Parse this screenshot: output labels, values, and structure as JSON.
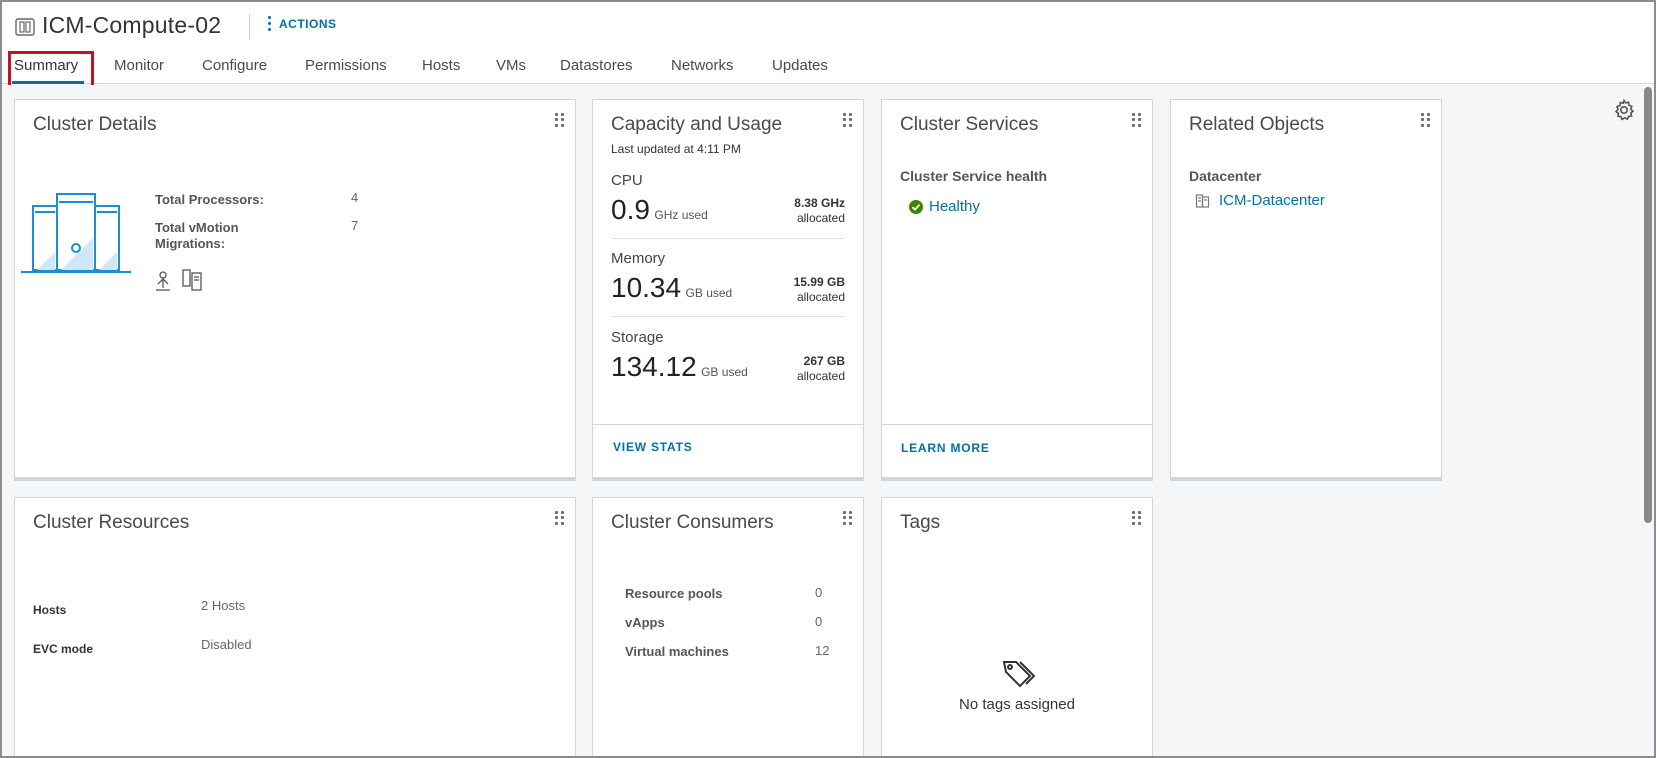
{
  "header": {
    "title": "ICM-Compute-02",
    "actions_label": "ACTIONS"
  },
  "tabs": [
    {
      "label": "Summary",
      "active": true
    },
    {
      "label": "Monitor"
    },
    {
      "label": "Configure"
    },
    {
      "label": "Permissions"
    },
    {
      "label": "Hosts"
    },
    {
      "label": "VMs"
    },
    {
      "label": "Datastores"
    },
    {
      "label": "Networks"
    },
    {
      "label": "Updates"
    }
  ],
  "cluster_details": {
    "title": "Cluster Details",
    "rows": [
      {
        "label": "Total Processors:",
        "value": "4"
      },
      {
        "label": "Total vMotion Migrations:",
        "value": "7"
      }
    ]
  },
  "capacity": {
    "title": "Capacity and Usage",
    "last_updated": "Last updated at 4:11 PM",
    "metrics": [
      {
        "name": "CPU",
        "used": "0.9",
        "unit": "GHz used",
        "allocated": "8.38 GHz",
        "allocated_label": "allocated"
      },
      {
        "name": "Memory",
        "used": "10.34",
        "unit": "GB used",
        "allocated": "15.99 GB",
        "allocated_label": "allocated"
      },
      {
        "name": "Storage",
        "used": "134.12",
        "unit": "GB used",
        "allocated": "267 GB",
        "allocated_label": "allocated"
      }
    ],
    "view_stats": "VIEW STATS"
  },
  "services": {
    "title": "Cluster Services",
    "health_label": "Cluster Service health",
    "health_status": "Healthy",
    "learn_more": "LEARN MORE"
  },
  "related": {
    "title": "Related Objects",
    "datacenter_label": "Datacenter",
    "datacenter_value": "ICM-Datacenter"
  },
  "resources": {
    "title": "Cluster Resources",
    "rows": [
      {
        "label": "Hosts",
        "value": "2 Hosts"
      },
      {
        "label": "EVC mode",
        "value": "Disabled"
      }
    ]
  },
  "consumers": {
    "title": "Cluster Consumers",
    "rows": [
      {
        "label": "Resource pools",
        "value": "0"
      },
      {
        "label": "vApps",
        "value": "0"
      },
      {
        "label": "Virtual machines",
        "value": "12"
      }
    ]
  },
  "tags": {
    "title": "Tags",
    "empty_text": "No tags assigned"
  },
  "colors": {
    "accent": "#0072a3",
    "healthy": "#3c8500",
    "highlight": "#c0141e"
  },
  "icons": {
    "object": "cluster-icon",
    "actions": "vertical-ellipsis-icon",
    "settings": "gear-icon",
    "healthy": "check-circle-icon",
    "datacenter": "datacenter-icon",
    "tag": "tag-icon"
  }
}
